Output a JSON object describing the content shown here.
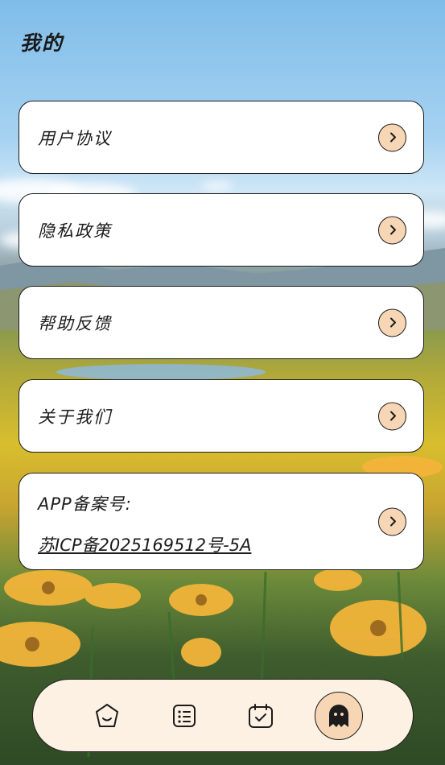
{
  "page": {
    "title": "我的"
  },
  "menu": [
    {
      "label": "用户协议",
      "icon": "chevron-right-icon"
    },
    {
      "label": "隐私政策",
      "icon": "chevron-right-icon"
    },
    {
      "label": "帮助反馈",
      "icon": "chevron-right-icon"
    },
    {
      "label": "关于我们",
      "icon": "chevron-right-icon"
    }
  ],
  "icp": {
    "label": "APP备案号:",
    "number": "苏ICP备2025169512号-5A"
  },
  "tabs": [
    {
      "icon": "home-face-icon",
      "active": false
    },
    {
      "icon": "list-icon",
      "active": false
    },
    {
      "icon": "calendar-check-icon",
      "active": false
    },
    {
      "icon": "ghost-icon",
      "active": true
    }
  ],
  "colors": {
    "card": "#ffffff",
    "accent": "#f7d6b5",
    "tabbar": "#fdf1e4",
    "border": "#1c1c1c"
  }
}
